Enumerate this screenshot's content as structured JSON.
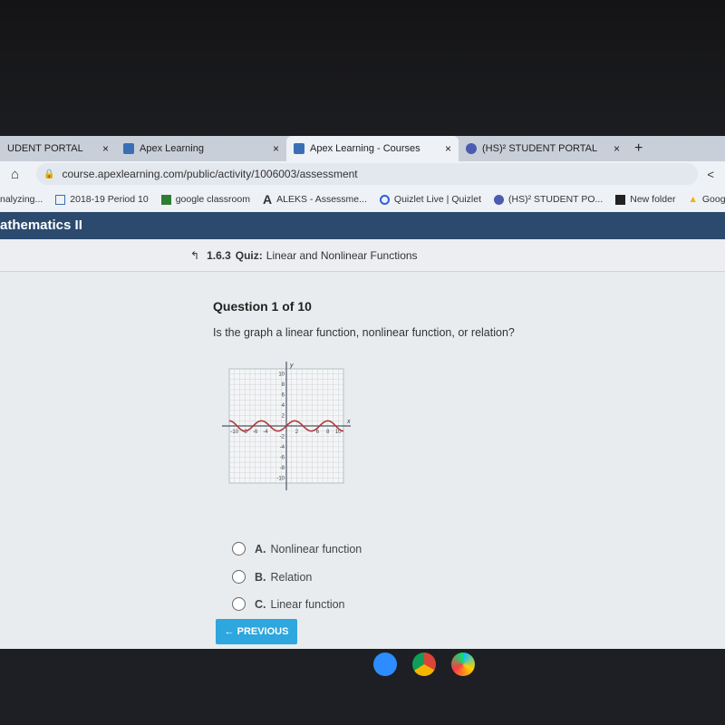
{
  "browser": {
    "tabs": [
      {
        "label": "UDENT PORTAL",
        "close": "×"
      },
      {
        "label": "Apex Learning",
        "close": "×"
      },
      {
        "label": "Apex Learning - Courses",
        "close": "×",
        "active": true
      },
      {
        "label": "(HS)² STUDENT PORTAL",
        "close": "×"
      }
    ],
    "new_tab": "+",
    "url": "course.apexlearning.com/public/activity/1006003/assessment",
    "bookmarks": [
      "nalyzing...",
      "2018-19 Period 10",
      "google classroom",
      "ALEKS - Assessme...",
      "Quizlet Live | Quizlet",
      "(HS)² STUDENT PO...",
      "New folder",
      "Google Drive"
    ]
  },
  "header": {
    "course": "athematics II"
  },
  "breadcrumb": {
    "icon": "up-arrow-icon",
    "number": "1.6.3",
    "type": "Quiz:",
    "title": "Linear and Nonlinear Functions"
  },
  "question": {
    "counter": "Question 1 of 10",
    "text": "Is the graph a linear function, nonlinear function, or relation?",
    "options": [
      {
        "letter": "A.",
        "label": "Nonlinear function"
      },
      {
        "letter": "B.",
        "label": "Relation"
      },
      {
        "letter": "C.",
        "label": "Linear function"
      }
    ]
  },
  "previous_label": "← PREVIOUS",
  "chart_data": {
    "type": "line",
    "xlabel": "x",
    "ylabel": "y",
    "xlim": [
      -11,
      11
    ],
    "ylim": [
      -11,
      11
    ],
    "x_ticks": [
      "-10",
      "-8",
      "-6",
      "-4",
      "2",
      "6",
      "8",
      "10"
    ],
    "y_ticks": [
      "10",
      "8",
      "6",
      "4",
      "2",
      "-2",
      "-4",
      "-6",
      "-8",
      "-10"
    ],
    "grid": true,
    "curve_color": "#b03a3a",
    "series": [
      {
        "x": [
          -11,
          -8,
          -4.8,
          -1.6,
          1.6,
          4.8,
          8,
          11
        ],
        "y": [
          1,
          -1,
          1,
          -1,
          1,
          -1,
          1,
          -1
        ]
      }
    ]
  }
}
